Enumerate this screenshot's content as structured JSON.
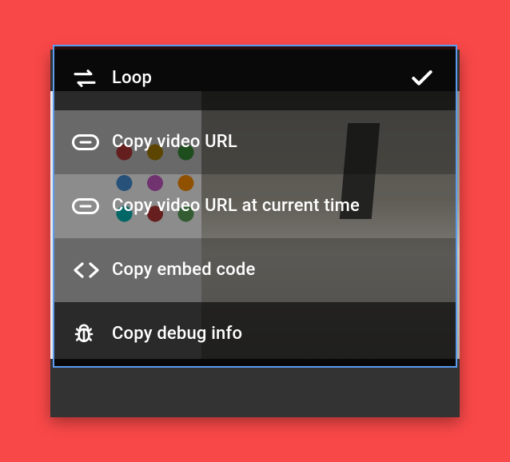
{
  "menu": {
    "items": [
      {
        "label": "Loop",
        "icon": "loop-icon",
        "checked": true
      },
      {
        "label": "Copy video URL",
        "icon": "link-icon",
        "checked": false
      },
      {
        "label": "Copy video URL at current time",
        "icon": "link-icon",
        "checked": false
      },
      {
        "label": "Copy embed code",
        "icon": "code-icon",
        "checked": false
      },
      {
        "label": "Copy debug info",
        "icon": "bug-icon",
        "checked": false
      }
    ]
  },
  "colors": {
    "page_bg": "#f94848",
    "menu_border": "#5a9cf0"
  }
}
